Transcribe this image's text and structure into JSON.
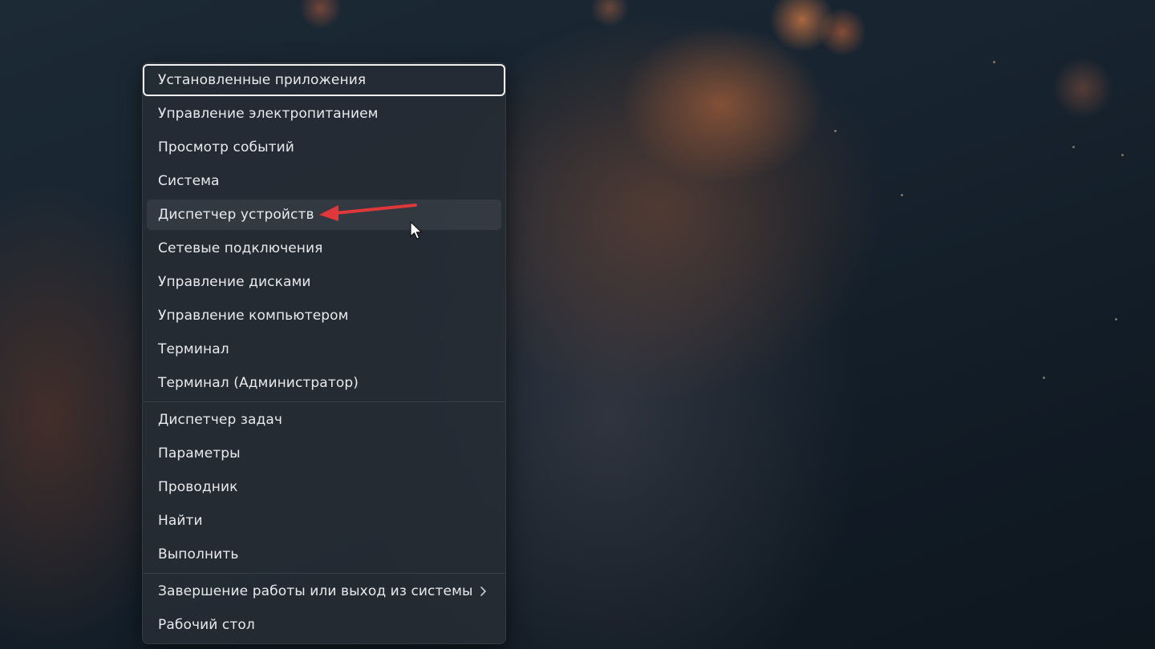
{
  "context_menu": {
    "items": [
      {
        "label": "Установленные приложения"
      },
      {
        "label": "Управление электропитанием"
      },
      {
        "label": "Просмотр событий"
      },
      {
        "label": "Система"
      },
      {
        "label": "Диспетчер устройств"
      },
      {
        "label": "Сетевые подключения"
      },
      {
        "label": "Управление дисками"
      },
      {
        "label": "Управление компьютером"
      },
      {
        "label": "Терминал"
      },
      {
        "label": "Терминал (Администратор)"
      },
      {
        "label": "Диспетчер задач"
      },
      {
        "label": "Параметры"
      },
      {
        "label": "Проводник"
      },
      {
        "label": "Найти"
      },
      {
        "label": "Выполнить"
      },
      {
        "label": "Завершение работы или выход из системы"
      },
      {
        "label": "Рабочий стол"
      }
    ],
    "focused_item": "Установленные приложения",
    "highlighted_item": "Диспетчер устройств"
  },
  "colors": {
    "annotation_arrow": "#e0383a",
    "menu_text": "#e8eaed"
  },
  "icons": {
    "submenu": "chevron-right-icon",
    "pointer": "mouse-cursor-icon",
    "annotation": "red-arrow-icon"
  }
}
